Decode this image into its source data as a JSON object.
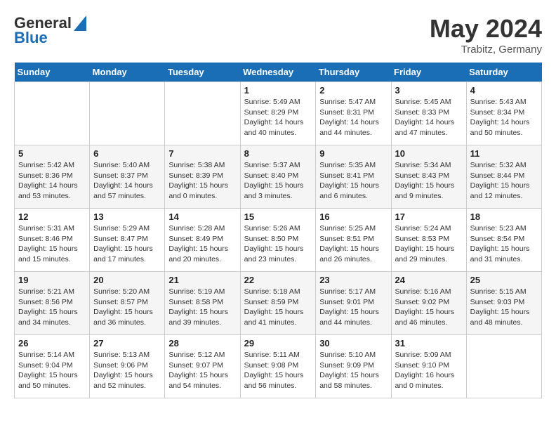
{
  "logo": {
    "line1": "General",
    "line2": "Blue"
  },
  "title": {
    "month_year": "May 2024",
    "location": "Trabitz, Germany"
  },
  "weekdays": [
    "Sunday",
    "Monday",
    "Tuesday",
    "Wednesday",
    "Thursday",
    "Friday",
    "Saturday"
  ],
  "weeks": [
    [
      {
        "day": "",
        "info": ""
      },
      {
        "day": "",
        "info": ""
      },
      {
        "day": "",
        "info": ""
      },
      {
        "day": "1",
        "info": "Sunrise: 5:49 AM\nSunset: 8:29 PM\nDaylight: 14 hours\nand 40 minutes."
      },
      {
        "day": "2",
        "info": "Sunrise: 5:47 AM\nSunset: 8:31 PM\nDaylight: 14 hours\nand 44 minutes."
      },
      {
        "day": "3",
        "info": "Sunrise: 5:45 AM\nSunset: 8:33 PM\nDaylight: 14 hours\nand 47 minutes."
      },
      {
        "day": "4",
        "info": "Sunrise: 5:43 AM\nSunset: 8:34 PM\nDaylight: 14 hours\nand 50 minutes."
      }
    ],
    [
      {
        "day": "5",
        "info": "Sunrise: 5:42 AM\nSunset: 8:36 PM\nDaylight: 14 hours\nand 53 minutes."
      },
      {
        "day": "6",
        "info": "Sunrise: 5:40 AM\nSunset: 8:37 PM\nDaylight: 14 hours\nand 57 minutes."
      },
      {
        "day": "7",
        "info": "Sunrise: 5:38 AM\nSunset: 8:39 PM\nDaylight: 15 hours\nand 0 minutes."
      },
      {
        "day": "8",
        "info": "Sunrise: 5:37 AM\nSunset: 8:40 PM\nDaylight: 15 hours\nand 3 minutes."
      },
      {
        "day": "9",
        "info": "Sunrise: 5:35 AM\nSunset: 8:41 PM\nDaylight: 15 hours\nand 6 minutes."
      },
      {
        "day": "10",
        "info": "Sunrise: 5:34 AM\nSunset: 8:43 PM\nDaylight: 15 hours\nand 9 minutes."
      },
      {
        "day": "11",
        "info": "Sunrise: 5:32 AM\nSunset: 8:44 PM\nDaylight: 15 hours\nand 12 minutes."
      }
    ],
    [
      {
        "day": "12",
        "info": "Sunrise: 5:31 AM\nSunset: 8:46 PM\nDaylight: 15 hours\nand 15 minutes."
      },
      {
        "day": "13",
        "info": "Sunrise: 5:29 AM\nSunset: 8:47 PM\nDaylight: 15 hours\nand 17 minutes."
      },
      {
        "day": "14",
        "info": "Sunrise: 5:28 AM\nSunset: 8:49 PM\nDaylight: 15 hours\nand 20 minutes."
      },
      {
        "day": "15",
        "info": "Sunrise: 5:26 AM\nSunset: 8:50 PM\nDaylight: 15 hours\nand 23 minutes."
      },
      {
        "day": "16",
        "info": "Sunrise: 5:25 AM\nSunset: 8:51 PM\nDaylight: 15 hours\nand 26 minutes."
      },
      {
        "day": "17",
        "info": "Sunrise: 5:24 AM\nSunset: 8:53 PM\nDaylight: 15 hours\nand 29 minutes."
      },
      {
        "day": "18",
        "info": "Sunrise: 5:23 AM\nSunset: 8:54 PM\nDaylight: 15 hours\nand 31 minutes."
      }
    ],
    [
      {
        "day": "19",
        "info": "Sunrise: 5:21 AM\nSunset: 8:56 PM\nDaylight: 15 hours\nand 34 minutes."
      },
      {
        "day": "20",
        "info": "Sunrise: 5:20 AM\nSunset: 8:57 PM\nDaylight: 15 hours\nand 36 minutes."
      },
      {
        "day": "21",
        "info": "Sunrise: 5:19 AM\nSunset: 8:58 PM\nDaylight: 15 hours\nand 39 minutes."
      },
      {
        "day": "22",
        "info": "Sunrise: 5:18 AM\nSunset: 8:59 PM\nDaylight: 15 hours\nand 41 minutes."
      },
      {
        "day": "23",
        "info": "Sunrise: 5:17 AM\nSunset: 9:01 PM\nDaylight: 15 hours\nand 44 minutes."
      },
      {
        "day": "24",
        "info": "Sunrise: 5:16 AM\nSunset: 9:02 PM\nDaylight: 15 hours\nand 46 minutes."
      },
      {
        "day": "25",
        "info": "Sunrise: 5:15 AM\nSunset: 9:03 PM\nDaylight: 15 hours\nand 48 minutes."
      }
    ],
    [
      {
        "day": "26",
        "info": "Sunrise: 5:14 AM\nSunset: 9:04 PM\nDaylight: 15 hours\nand 50 minutes."
      },
      {
        "day": "27",
        "info": "Sunrise: 5:13 AM\nSunset: 9:06 PM\nDaylight: 15 hours\nand 52 minutes."
      },
      {
        "day": "28",
        "info": "Sunrise: 5:12 AM\nSunset: 9:07 PM\nDaylight: 15 hours\nand 54 minutes."
      },
      {
        "day": "29",
        "info": "Sunrise: 5:11 AM\nSunset: 9:08 PM\nDaylight: 15 hours\nand 56 minutes."
      },
      {
        "day": "30",
        "info": "Sunrise: 5:10 AM\nSunset: 9:09 PM\nDaylight: 15 hours\nand 58 minutes."
      },
      {
        "day": "31",
        "info": "Sunrise: 5:09 AM\nSunset: 9:10 PM\nDaylight: 16 hours\nand 0 minutes."
      },
      {
        "day": "",
        "info": ""
      }
    ]
  ]
}
